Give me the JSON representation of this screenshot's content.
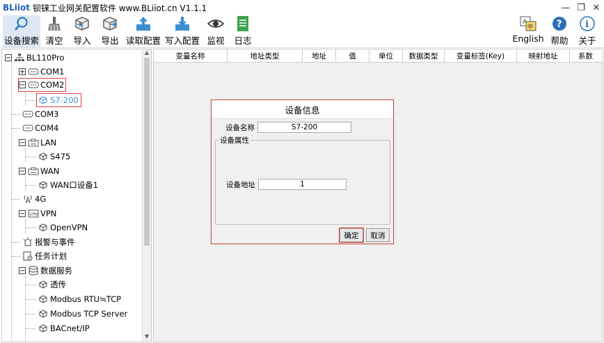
{
  "window": {
    "brand": "BLiiot",
    "title": "钡铼工业网关配置软件 www.BLiiot.cn V1.1.1",
    "controls": [
      "—",
      "❐",
      "✕"
    ]
  },
  "toolbar": {
    "device_search": "设备搜索",
    "clear": "清空",
    "import": "导入",
    "export": "导出",
    "read_config": "读取配置",
    "write_config": "写入配置",
    "monitor": "监视",
    "log": "日志",
    "english": "English",
    "help": "帮助",
    "about": "关于"
  },
  "tree": {
    "root": "BL110Pro",
    "com1": "COM1",
    "com2": "COM2",
    "s7200": "S7-200",
    "com3": "COM3",
    "com4": "COM4",
    "lan": "LAN",
    "s475": "S475",
    "wan": "WAN",
    "wan_device": "WAN口设备1",
    "g4": "4G",
    "vpn": "VPN",
    "openvpn": "OpenVPN",
    "alarm": "报警与事件",
    "task": "任务计划",
    "data_service": "数据服务",
    "transparent": "透传",
    "modbus_rtu_tcp": "Modbus RTU≒TCP",
    "modbus_tcp_server": "Modbus TCP Server",
    "bacnet": "BACnet/IP"
  },
  "grid": {
    "columns": [
      "变量名称",
      "地址类型",
      "地址",
      "值",
      "单位",
      "数据类型",
      "变量标签(Key)",
      "映射地址",
      "系数"
    ]
  },
  "dialog": {
    "title": "设备信息",
    "name_label": "设备名称",
    "name_value": "S7-200",
    "group_label": "设备属性",
    "addr_label": "设备地址",
    "addr_value": "1",
    "ok": "确定",
    "cancel": "取消"
  },
  "colors": {
    "brand": "#1f5fbf",
    "highlight": "#e04040",
    "selected": "#3a8fd0"
  }
}
